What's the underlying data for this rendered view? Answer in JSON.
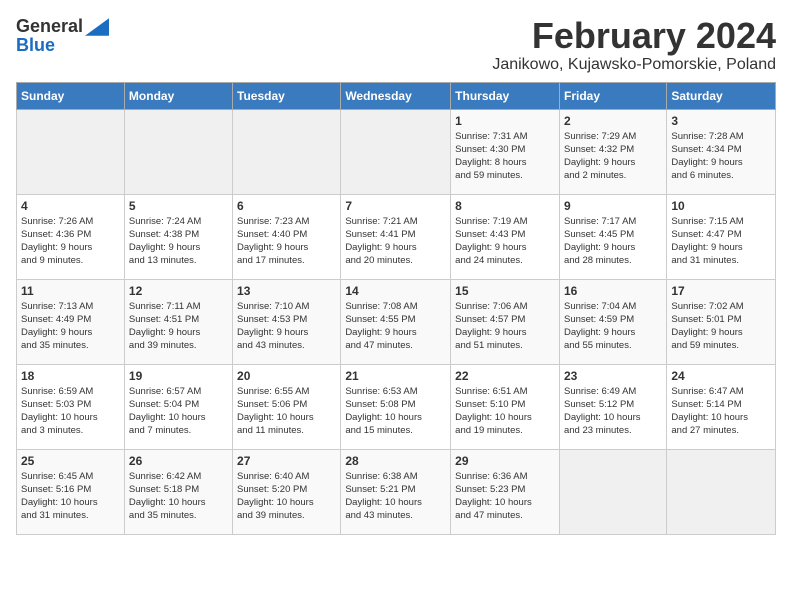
{
  "logo": {
    "general": "General",
    "blue": "Blue"
  },
  "title": {
    "month_year": "February 2024",
    "location": "Janikowo, Kujawsko-Pomorskie, Poland"
  },
  "weekdays": [
    "Sunday",
    "Monday",
    "Tuesday",
    "Wednesday",
    "Thursday",
    "Friday",
    "Saturday"
  ],
  "weeks": [
    [
      {
        "day": "",
        "info": ""
      },
      {
        "day": "",
        "info": ""
      },
      {
        "day": "",
        "info": ""
      },
      {
        "day": "",
        "info": ""
      },
      {
        "day": "1",
        "info": "Sunrise: 7:31 AM\nSunset: 4:30 PM\nDaylight: 8 hours\nand 59 minutes."
      },
      {
        "day": "2",
        "info": "Sunrise: 7:29 AM\nSunset: 4:32 PM\nDaylight: 9 hours\nand 2 minutes."
      },
      {
        "day": "3",
        "info": "Sunrise: 7:28 AM\nSunset: 4:34 PM\nDaylight: 9 hours\nand 6 minutes."
      }
    ],
    [
      {
        "day": "4",
        "info": "Sunrise: 7:26 AM\nSunset: 4:36 PM\nDaylight: 9 hours\nand 9 minutes."
      },
      {
        "day": "5",
        "info": "Sunrise: 7:24 AM\nSunset: 4:38 PM\nDaylight: 9 hours\nand 13 minutes."
      },
      {
        "day": "6",
        "info": "Sunrise: 7:23 AM\nSunset: 4:40 PM\nDaylight: 9 hours\nand 17 minutes."
      },
      {
        "day": "7",
        "info": "Sunrise: 7:21 AM\nSunset: 4:41 PM\nDaylight: 9 hours\nand 20 minutes."
      },
      {
        "day": "8",
        "info": "Sunrise: 7:19 AM\nSunset: 4:43 PM\nDaylight: 9 hours\nand 24 minutes."
      },
      {
        "day": "9",
        "info": "Sunrise: 7:17 AM\nSunset: 4:45 PM\nDaylight: 9 hours\nand 28 minutes."
      },
      {
        "day": "10",
        "info": "Sunrise: 7:15 AM\nSunset: 4:47 PM\nDaylight: 9 hours\nand 31 minutes."
      }
    ],
    [
      {
        "day": "11",
        "info": "Sunrise: 7:13 AM\nSunset: 4:49 PM\nDaylight: 9 hours\nand 35 minutes."
      },
      {
        "day": "12",
        "info": "Sunrise: 7:11 AM\nSunset: 4:51 PM\nDaylight: 9 hours\nand 39 minutes."
      },
      {
        "day": "13",
        "info": "Sunrise: 7:10 AM\nSunset: 4:53 PM\nDaylight: 9 hours\nand 43 minutes."
      },
      {
        "day": "14",
        "info": "Sunrise: 7:08 AM\nSunset: 4:55 PM\nDaylight: 9 hours\nand 47 minutes."
      },
      {
        "day": "15",
        "info": "Sunrise: 7:06 AM\nSunset: 4:57 PM\nDaylight: 9 hours\nand 51 minutes."
      },
      {
        "day": "16",
        "info": "Sunrise: 7:04 AM\nSunset: 4:59 PM\nDaylight: 9 hours\nand 55 minutes."
      },
      {
        "day": "17",
        "info": "Sunrise: 7:02 AM\nSunset: 5:01 PM\nDaylight: 9 hours\nand 59 minutes."
      }
    ],
    [
      {
        "day": "18",
        "info": "Sunrise: 6:59 AM\nSunset: 5:03 PM\nDaylight: 10 hours\nand 3 minutes."
      },
      {
        "day": "19",
        "info": "Sunrise: 6:57 AM\nSunset: 5:04 PM\nDaylight: 10 hours\nand 7 minutes."
      },
      {
        "day": "20",
        "info": "Sunrise: 6:55 AM\nSunset: 5:06 PM\nDaylight: 10 hours\nand 11 minutes."
      },
      {
        "day": "21",
        "info": "Sunrise: 6:53 AM\nSunset: 5:08 PM\nDaylight: 10 hours\nand 15 minutes."
      },
      {
        "day": "22",
        "info": "Sunrise: 6:51 AM\nSunset: 5:10 PM\nDaylight: 10 hours\nand 19 minutes."
      },
      {
        "day": "23",
        "info": "Sunrise: 6:49 AM\nSunset: 5:12 PM\nDaylight: 10 hours\nand 23 minutes."
      },
      {
        "day": "24",
        "info": "Sunrise: 6:47 AM\nSunset: 5:14 PM\nDaylight: 10 hours\nand 27 minutes."
      }
    ],
    [
      {
        "day": "25",
        "info": "Sunrise: 6:45 AM\nSunset: 5:16 PM\nDaylight: 10 hours\nand 31 minutes."
      },
      {
        "day": "26",
        "info": "Sunrise: 6:42 AM\nSunset: 5:18 PM\nDaylight: 10 hours\nand 35 minutes."
      },
      {
        "day": "27",
        "info": "Sunrise: 6:40 AM\nSunset: 5:20 PM\nDaylight: 10 hours\nand 39 minutes."
      },
      {
        "day": "28",
        "info": "Sunrise: 6:38 AM\nSunset: 5:21 PM\nDaylight: 10 hours\nand 43 minutes."
      },
      {
        "day": "29",
        "info": "Sunrise: 6:36 AM\nSunset: 5:23 PM\nDaylight: 10 hours\nand 47 minutes."
      },
      {
        "day": "",
        "info": ""
      },
      {
        "day": "",
        "info": ""
      }
    ]
  ]
}
